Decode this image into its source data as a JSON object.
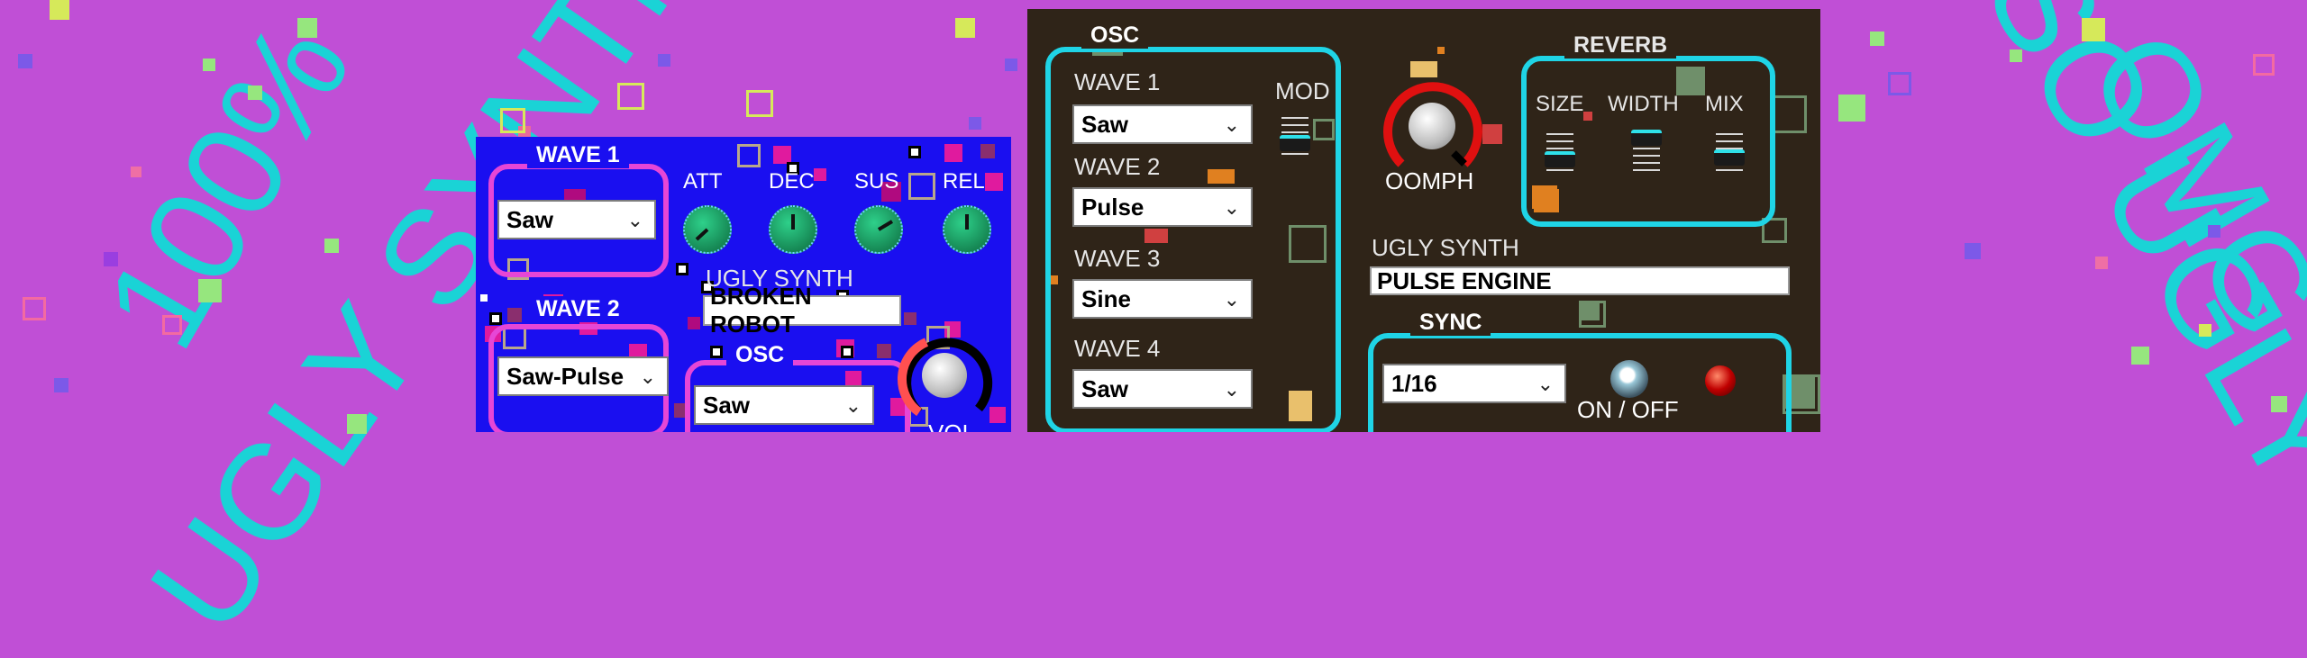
{
  "background": {
    "color": "#c04fd6",
    "words": [
      "100%",
      "UGLY SYNTHS",
      "OMG",
      "SO UGLY"
    ]
  },
  "left_panel": {
    "wave1": {
      "title": "WAVE 1",
      "value": "Saw"
    },
    "wave2": {
      "title": "WAVE 2",
      "value": "Saw-Pulse"
    },
    "envelope": [
      "ATT",
      "DEC",
      "SUS",
      "REL"
    ],
    "name_label": "UGLY SYNTH",
    "name_value": "BROKEN ROBOT",
    "osc": {
      "title": "OSC",
      "value": "Saw"
    },
    "vol_label": "VOL"
  },
  "right_panel": {
    "osc": {
      "title": "OSC",
      "waves": [
        {
          "label": "WAVE 1",
          "value": "Saw"
        },
        {
          "label": "WAVE 2",
          "value": "Pulse"
        },
        {
          "label": "WAVE 3",
          "value": "Sine"
        },
        {
          "label": "WAVE 4",
          "value": "Saw"
        }
      ],
      "mod_label": "MOD"
    },
    "oomph_label": "OOMPH",
    "reverb": {
      "title": "REVERB",
      "faders": [
        "SIZE",
        "WIDTH",
        "MIX"
      ]
    },
    "name_label": "UGLY SYNTH",
    "name_value": "PULSE ENGINE",
    "sync": {
      "title": "SYNC",
      "value": "1/16",
      "toggle_label": "ON / OFF"
    }
  },
  "colors": {
    "accent_cyan": "#1fd4e6",
    "pink_frame": "#e646d6",
    "left_bg": "#1a0ff0",
    "right_bg": "#2f2418",
    "oomph_ring": "#e01010"
  },
  "icons": {
    "chevron": "chevron-down-icon"
  }
}
